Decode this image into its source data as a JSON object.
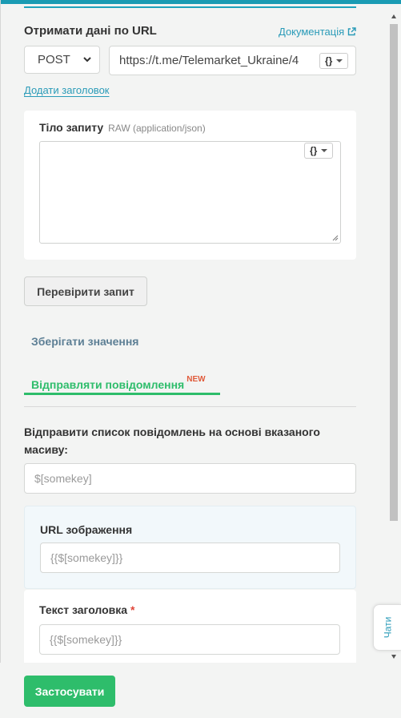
{
  "request": {
    "title": "Отримати дані по URL",
    "docs_link": "Документація",
    "method": "POST",
    "url": "https://t.me/Telemarket_Ukraine/4",
    "var_button": "{}",
    "add_header": "Додати заголовок"
  },
  "body": {
    "title": "Тіло запиту",
    "format": "RAW (application/json)",
    "value": ""
  },
  "check_button": "Перевірити запит",
  "tabs": {
    "save_values": "Зберігати значення",
    "send_messages": "Відправляти повідомлення",
    "new_badge": "NEW"
  },
  "messages": {
    "description": "Відправити список повідомлень на основі вказаного масиву:",
    "array_placeholder": "$[somekey]",
    "image_url_label": "URL зображення",
    "image_url_placeholder": "{{$[somekey]}}",
    "heading_label": "Текст заголовка",
    "required_mark": "*",
    "heading_placeholder": "{{$[somekey]}}"
  },
  "chat_tab": "Чати",
  "apply_button": "Застосувати",
  "colors": {
    "accent": "#2a9bb8",
    "primary": "#2ebd6b",
    "danger": "#e0463a"
  },
  "icons": [
    "external-link-icon",
    "chevron-down-icon",
    "caret-down-icon",
    "resize-handle-icon"
  ]
}
